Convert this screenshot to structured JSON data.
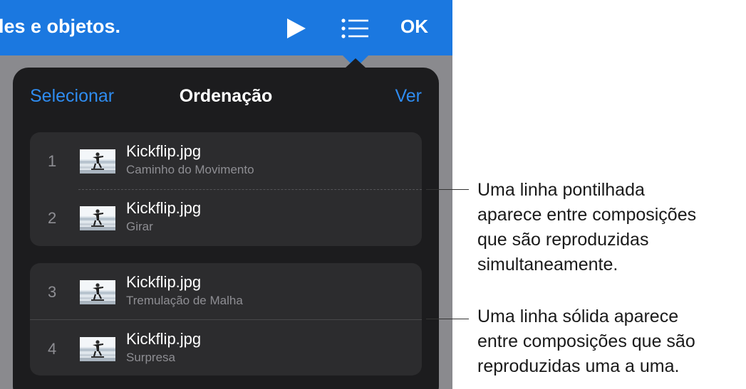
{
  "topbar": {
    "title": "les e objetos.",
    "play_icon": "play-icon",
    "list_icon": "list-icon",
    "ok_label": "OK",
    "color": "#1b78e0"
  },
  "popover": {
    "select_label": "Selecionar",
    "title": "Ordenação",
    "view_label": "Ver",
    "accent": "#2f8cf0",
    "groups": [
      {
        "items": [
          {
            "number": "1",
            "title": "Kickflip.jpg",
            "subtitle": "Caminho do Movimento"
          },
          {
            "number": "2",
            "title": "Kickflip.jpg",
            "subtitle": "Girar"
          }
        ]
      },
      {
        "items": [
          {
            "number": "3",
            "title": "Kickflip.jpg",
            "subtitle": "Tremulação de Malha"
          },
          {
            "number": "4",
            "title": "Kickflip.jpg",
            "subtitle": "Surpresa"
          }
        ]
      }
    ]
  },
  "callouts": {
    "dotted": "Uma linha pontilhada\naparece entre composições\nque são reproduzidas\nsimultaneamente.",
    "solid": "Uma linha sólida aparece\nentre composições que são\nreproduzidas uma a uma."
  }
}
